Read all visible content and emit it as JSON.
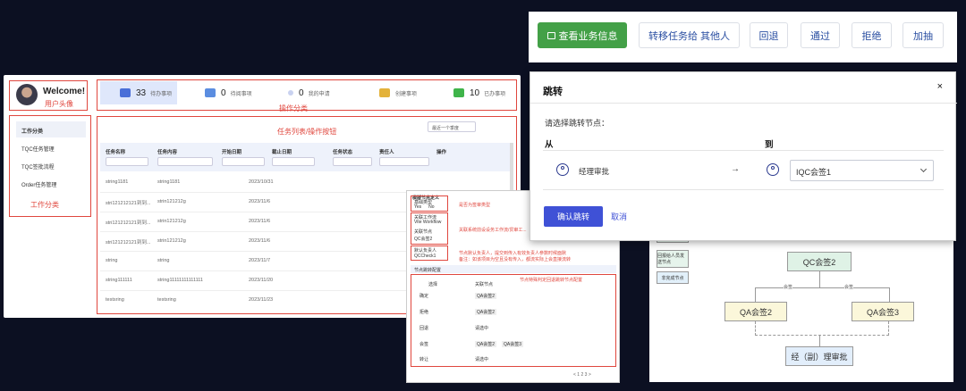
{
  "dashboard": {
    "annotations": {
      "top_label": "",
      "avatar": "用户头像",
      "ops_category": "操作分类",
      "task_list": "任务列表/操作按钮",
      "work_category": "工作分类"
    },
    "welcome": "Welcome!",
    "stats": [
      {
        "count": "33",
        "label": "待办事项",
        "color": "#4a6fd8"
      },
      {
        "count": "0",
        "label": "待阅事项",
        "color": "#5b8de0"
      },
      {
        "count": "0",
        "label": "我的申请",
        "color": "#c9d2f0"
      },
      {
        "count": "",
        "label": "创建事项",
        "color": "#e3b23a"
      },
      {
        "count": "10",
        "label": "已办事项",
        "color": "#3fb44a"
      }
    ],
    "menu": [
      "工作分类",
      "TQC任务管理",
      "TQC签批流程",
      "Order任务管理"
    ],
    "table": {
      "sort_label": "最近一个季度",
      "columns": [
        "任务名称",
        "任务内容",
        "开始日期",
        "截止日期",
        "任务状态",
        "责任人",
        "操作"
      ],
      "rows": [
        {
          "name": "string1181",
          "content": "string1181",
          "date": "2023/10/31"
        },
        {
          "name": "stri121212121到到...",
          "content": "strin121212g",
          "date": "2023/11/6"
        },
        {
          "name": "stri121212121到到...",
          "content": "strin121212g",
          "date": "2023/11/6"
        },
        {
          "name": "stri121212121到到...",
          "content": "strin121212g",
          "date": "2023/11/6"
        },
        {
          "name": "string",
          "content": "string",
          "date": "2023/11/7"
        },
        {
          "name": "string111111",
          "content": "string11111111111111",
          "date": "2023/11/20"
        },
        {
          "name": "testsring",
          "content": "testsring",
          "date": "2023/11/23"
        }
      ]
    }
  },
  "config": {
    "title": "模版节点定义",
    "section_type": "基础类型",
    "radio_yes": "Yes",
    "radio_no": "No",
    "workflow_label": "关联工作流",
    "workflow_value": "Vite Workflow",
    "node_label": "关联节点",
    "node_value": "QC会签2",
    "default_owner_label": "默认负责人",
    "default_owner_value": "QCCheck1",
    "note1": "是否为签审类型",
    "note2": "关联系统前设设务工作流/贯审工...",
    "note3": "节点默认负责人，提交到传入有效负责人参数时候面默",
    "note4": "备注：如该项目为空且没有传入，都流实际上会直接流转",
    "sub_title": "节点跳转配置",
    "sub_note": "节点特殊判定回退跳转节点配置",
    "sub_cols": [
      "选择",
      "关联节点"
    ],
    "sub_rows": [
      {
        "name": "确定",
        "tags": [
          "QA会签2"
        ]
      },
      {
        "name": "拒绝",
        "tags": [
          "QA会签2"
        ]
      },
      {
        "name": "回退",
        "tags": [
          "请选中"
        ]
      },
      {
        "name": "会签",
        "tags": [
          "QA会签2",
          "QA会签3"
        ]
      },
      {
        "name": "转让",
        "tags": [
          "请选中"
        ]
      }
    ],
    "pager": "< 1 2 3 >"
  },
  "actions": {
    "primary": "查看业务信息",
    "transfer": "转移任务给 其他人",
    "rollback": "回退",
    "approve": "通过",
    "reject": "拒绝",
    "add_sign": "加抽"
  },
  "flow": {
    "left_nodes": [
      "",
      "回报给人员发送节点",
      "非完成节点"
    ],
    "qc": "QC会签2",
    "qa2": "QA会签2",
    "qa3": "QA会签3",
    "final": "经（副）理审批",
    "branch_label": "会签"
  },
  "modal": {
    "title": "跳转",
    "close": "×",
    "prompt": "请选择跳转节点：",
    "from_label": "从",
    "to_label": "到",
    "from_value": "经理审批",
    "arrow": "→",
    "to_value": "IQC会签1",
    "confirm": "确认跳转",
    "cancel": "取消"
  },
  "colors": {
    "accent": "#3f51d6",
    "success": "#43a047",
    "annotation_red": "#e0473e"
  }
}
